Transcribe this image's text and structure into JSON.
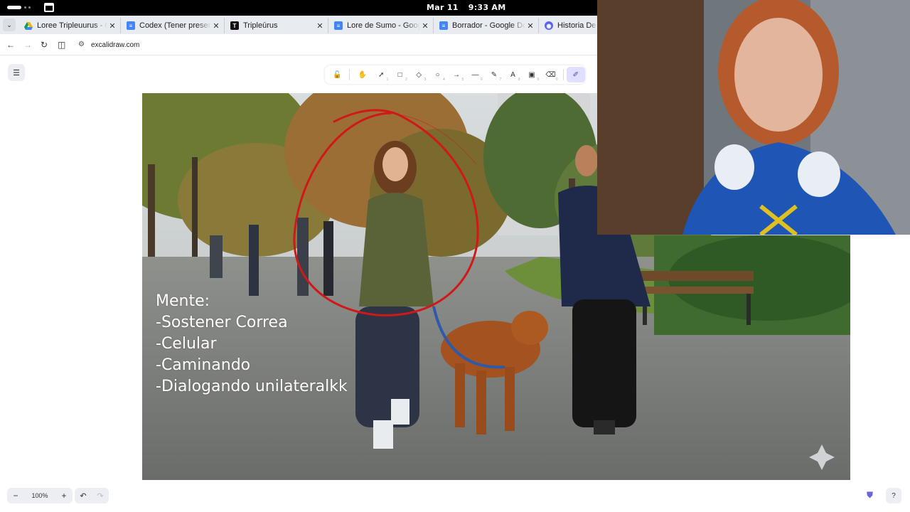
{
  "system": {
    "date": "Mar 11",
    "time": "9:33 AM"
  },
  "browser": {
    "tabs": [
      {
        "title": "Loree Tripleuurus - Go",
        "icon": "google-drive-icon",
        "color": "#f4b400"
      },
      {
        "title": "Codex (Tener presente",
        "icon": "google-docs-icon",
        "color": "#4285f4"
      },
      {
        "title": "Tripleūrus",
        "icon": "t-logo-icon",
        "color": "#111111"
      },
      {
        "title": "Lore de Sumo - Google",
        "icon": "google-docs-icon",
        "color": "#4285f4"
      },
      {
        "title": "Borrador - Google Doc",
        "icon": "google-docs-icon",
        "color": "#4285f4"
      },
      {
        "title": "Historia De Lo",
        "icon": "discord-icon",
        "color": "#5865f2"
      }
    ],
    "url": "excalidraw.com"
  },
  "excalidraw": {
    "toolbar": [
      {
        "name": "lock",
        "glyph": "🔓",
        "key": ""
      },
      {
        "name": "hand",
        "glyph": "✋",
        "key": ""
      },
      {
        "name": "selection",
        "glyph": "➚",
        "key": "1"
      },
      {
        "name": "rectangle",
        "glyph": "□",
        "key": "2"
      },
      {
        "name": "diamond",
        "glyph": "◇",
        "key": "3"
      },
      {
        "name": "ellipse",
        "glyph": "○",
        "key": "4"
      },
      {
        "name": "arrow",
        "glyph": "→",
        "key": "5"
      },
      {
        "name": "line",
        "glyph": "—",
        "key": "6"
      },
      {
        "name": "draw",
        "glyph": "✎",
        "key": "7"
      },
      {
        "name": "text",
        "glyph": "A",
        "key": "8"
      },
      {
        "name": "image",
        "glyph": "▣",
        "key": "9"
      },
      {
        "name": "eraser",
        "glyph": "⌫",
        "key": "0"
      },
      {
        "name": "laser",
        "glyph": "✐",
        "key": ""
      }
    ],
    "active_tool": "laser",
    "zoom": "100%",
    "canvas_text": [
      "Mente:",
      "-Sostener Correa",
      "-Celular",
      "-Caminando",
      "-Dialogando unilateralkk"
    ],
    "annotation_color": "#d01818"
  }
}
